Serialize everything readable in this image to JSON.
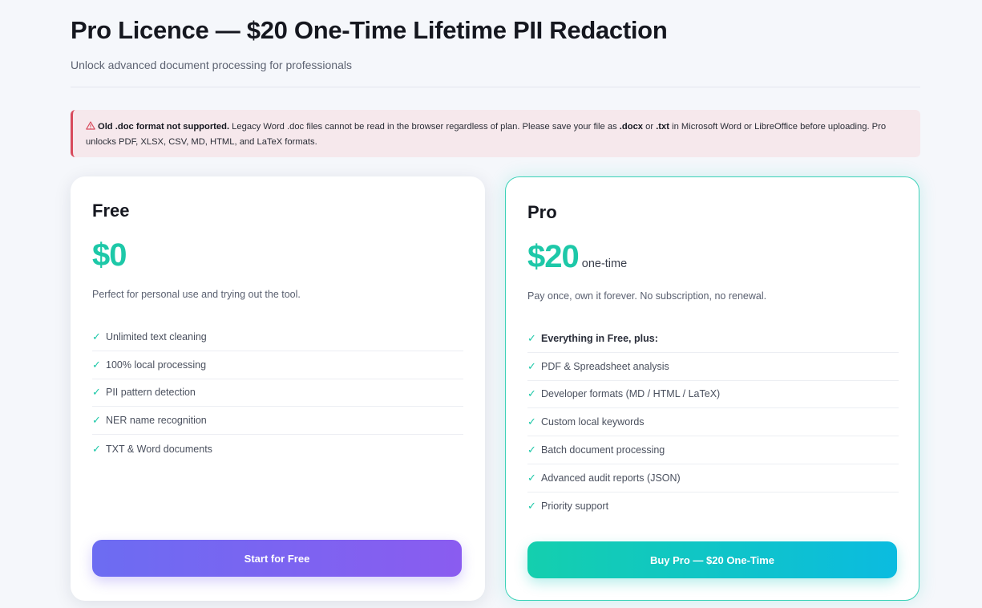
{
  "header": {
    "title": "Pro Licence — $20 One-Time Lifetime PII Redaction",
    "subtitle": "Unlock advanced document processing for professionals"
  },
  "alert": {
    "icon": "warning-triangle-icon",
    "bold": "Old .doc format not supported.",
    "text_1": " Legacy Word .doc files cannot be read in the browser regardless of plan. Please save your file as ",
    "ext_1": ".docx",
    "text_2": " or ",
    "ext_2": ".txt",
    "text_3": " in Microsoft Word or LibreOffice before uploading. Pro unlocks PDF, XLSX, CSV, MD, HTML, and LaTeX formats."
  },
  "plans": {
    "free": {
      "name": "Free",
      "price": "$0",
      "description": "Perfect for personal use and trying out the tool.",
      "features": [
        "Unlimited text cleaning",
        "100% local processing",
        "PII pattern detection",
        "NER name recognition",
        "TXT & Word documents"
      ],
      "button": "Start for Free"
    },
    "pro": {
      "name": "Pro",
      "price": "$20",
      "price_suffix": "one-time",
      "description": "Pay once, own it forever. No subscription, no renewal.",
      "features": [
        "Everything in Free, plus:",
        "PDF & Spreadsheet analysis",
        "Developer formats (MD / HTML / LaTeX)",
        "Custom local keywords",
        "Batch document processing",
        "Advanced audit reports (JSON)",
        "Priority support"
      ],
      "button": "Buy Pro — $20 One-Time"
    }
  },
  "colors": {
    "accent_teal": "#1dc8a8",
    "alert_border": "#d84a5c",
    "free_button_start": "#6c6cf2",
    "free_button_end": "#8a5cf0",
    "pro_button_start": "#14cfae",
    "pro_button_end": "#0bbbe0"
  },
  "icons": {
    "check": "✓"
  }
}
